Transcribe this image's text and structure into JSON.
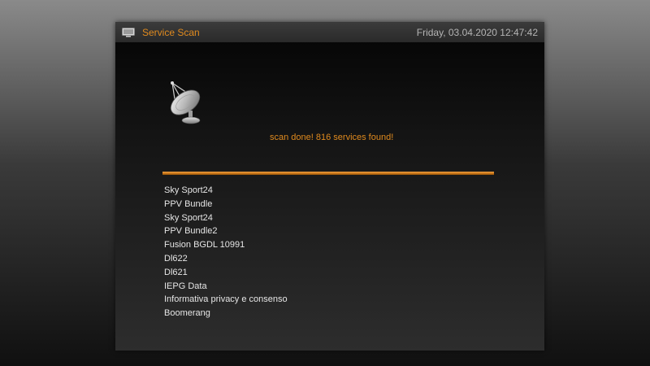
{
  "window": {
    "title": "Service Scan",
    "datetime": "Friday, 03.04.2020  12:47:42",
    "title_icon": "tv-screen-icon"
  },
  "scan": {
    "icon": "satellite-dish-icon",
    "status_text": "scan done! 816 services found!",
    "progress_percent": 100
  },
  "services": [
    "Sky Sport24",
    "PPV Bundle",
    "Sky Sport24",
    "PPV Bundle2",
    "Fusion BGDL 10991",
    "Dl622",
    "Dl621",
    "IEPG Data",
    "Informativa privacy e consenso",
    "Boomerang"
  ],
  "colors": {
    "accent": "#e08a1e",
    "text": "#e6e6e6",
    "datetime": "#b4b4b4"
  }
}
